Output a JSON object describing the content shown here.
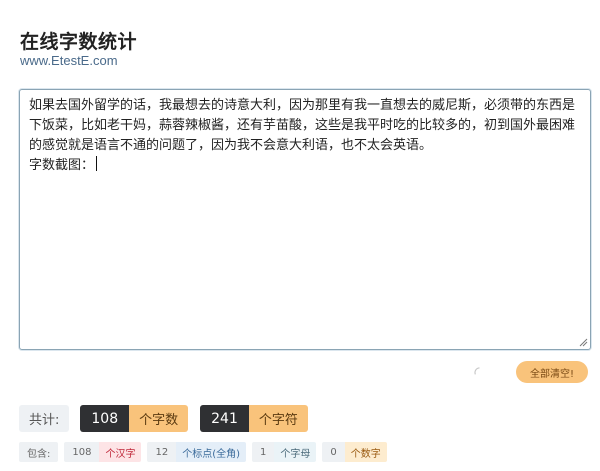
{
  "header": {
    "title": "在线字数统计",
    "subtitle": "www.EtestE.com"
  },
  "editor": {
    "line1": "如果去国外留学的话，我最想去的诗意大利，因为那里有我一直想去的威尼斯，必须带的东西是下饭菜，比如老干妈，蒜蓉辣椒酱，还有芋苗酸，这些是我平时吃的比较多的，初到国外最困难的感觉就是语言不通的问题了，因为我不会意大利语，也不太会英语。",
    "line2": "字数截图："
  },
  "actions": {
    "clear_label": "全部清空!"
  },
  "totals": {
    "label": "共计:",
    "chars_count": "108",
    "chars_unit": "个字数",
    "symbols_count": "241",
    "symbols_unit": "个字符"
  },
  "detail": {
    "label": "包含:",
    "items": [
      {
        "count": "108",
        "unit": "个汉字"
      },
      {
        "count": "12",
        "unit": "个标点(全角)"
      },
      {
        "count": "1",
        "unit": "个字母"
      },
      {
        "count": "0",
        "unit": "个数字"
      }
    ]
  }
}
